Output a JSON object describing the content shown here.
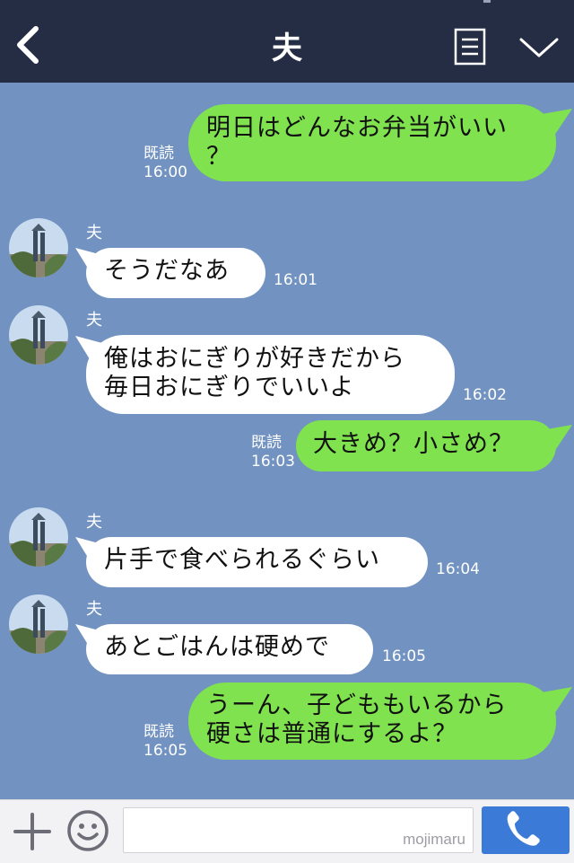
{
  "header": {
    "title": "夫",
    "back_icon": "chevron-left-icon",
    "notes_icon": "notes-icon",
    "collapse_icon": "chevron-down-icon"
  },
  "messages": [
    {
      "from": "me",
      "lines": [
        "明日はどんなお弁当がいい",
        "？"
      ],
      "read": "既読",
      "time": "16:00"
    },
    {
      "from": "them",
      "sender": "夫",
      "lines": [
        "そうだなあ"
      ],
      "time": "16:01"
    },
    {
      "from": "them",
      "sender": "夫",
      "lines": [
        "俺はおにぎりが好きだから",
        "毎日おにぎりでいいよ"
      ],
      "time": "16:02"
    },
    {
      "from": "me",
      "lines": [
        "大きめ？小さめ？"
      ],
      "read": "既読",
      "time": "16:03"
    },
    {
      "from": "them",
      "sender": "夫",
      "lines": [
        "片手で食べられるぐらい"
      ],
      "time": "16:04"
    },
    {
      "from": "them",
      "sender": "夫",
      "lines": [
        "あとごはんは硬めで"
      ],
      "time": "16:05"
    },
    {
      "from": "me",
      "lines": [
        "うーん、子どももいるから",
        "硬さは普通にするよ？"
      ],
      "read": "既読",
      "time": "16:05"
    }
  ],
  "footer": {
    "input_value": "",
    "watermark": "mojimaru",
    "plus_icon": "plus-icon",
    "emoji_icon": "smiley-icon",
    "call_icon": "phone-icon"
  },
  "colors": {
    "header_bg": "#252d45",
    "chat_bg": "#7293c1",
    "my_bubble": "#7fe24e",
    "their_bubble": "#ffffff",
    "call_button": "#3b7ad7"
  }
}
